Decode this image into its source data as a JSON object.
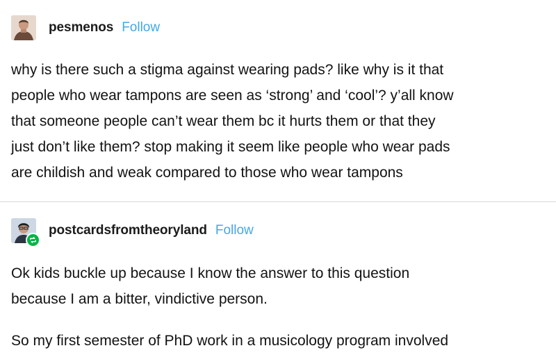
{
  "post1": {
    "username": "pesmenos",
    "follow_label": "Follow",
    "lines": [
      "why is there such a stigma against wearing pads? like why is it that",
      "people who wear tampons are seen as ‘strong’ and ‘cool’? y’all know",
      "that someone people can’t wear them bc it hurts them or that they",
      "just don’t like them? stop making it seem like people who wear pads",
      "are childish and weak compared to those who wear tampons"
    ]
  },
  "post2": {
    "username": "postcardsfromtheoryland",
    "follow_label": "Follow",
    "lines": [
      "Ok kids buckle up because I know the answer to this question",
      "because I am a bitter, vindictive person.",
      "So my first semester of PhD work in a musicology program involved"
    ]
  },
  "colors": {
    "follow": "#3fa9e8",
    "reblog_badge": "#00b545",
    "divider": "#d8d8d8"
  },
  "icons": {
    "post1_avatar": "avatar",
    "post2_avatar": "avatar",
    "reblog": "reblog-icon"
  }
}
